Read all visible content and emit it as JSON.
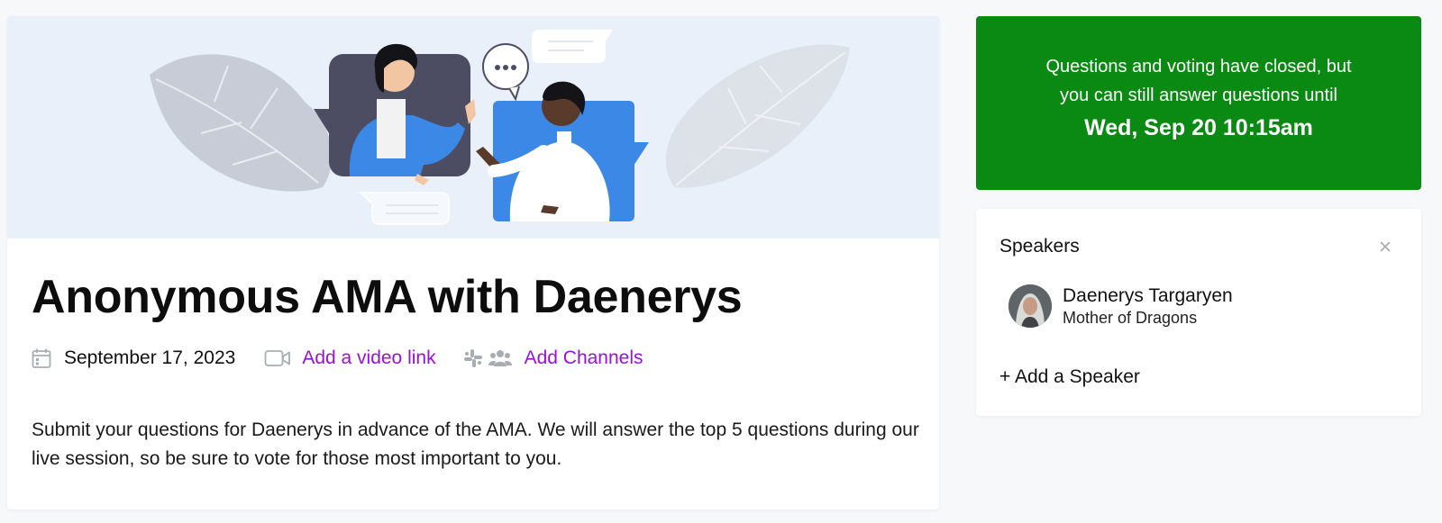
{
  "event": {
    "title": "Anonymous AMA with Daenerys",
    "date": "September 17, 2023",
    "video_link_label": "Add a video link",
    "channels_label": "Add Channels",
    "description": "Submit your questions for Daenerys in advance of the AMA. We will answer the top 5 questions during our live session, so be sure to vote for those most important to you."
  },
  "status": {
    "line1": "Questions and voting have closed, but",
    "line2": "you can still answer questions until",
    "deadline": "Wed, Sep 20 10:15am",
    "color": "#0a8a12"
  },
  "speakers": {
    "title": "Speakers",
    "items": [
      {
        "name": "Daenerys Targaryen",
        "role": "Mother of Dragons"
      }
    ],
    "add_label": "+ Add a Speaker"
  },
  "icons": [
    "calendar-icon",
    "video-camera-icon",
    "slack-icon",
    "groups-icon",
    "close-icon"
  ],
  "colors": {
    "accent": "#9b10d9",
    "hero_bg": "#e9f0f9"
  }
}
